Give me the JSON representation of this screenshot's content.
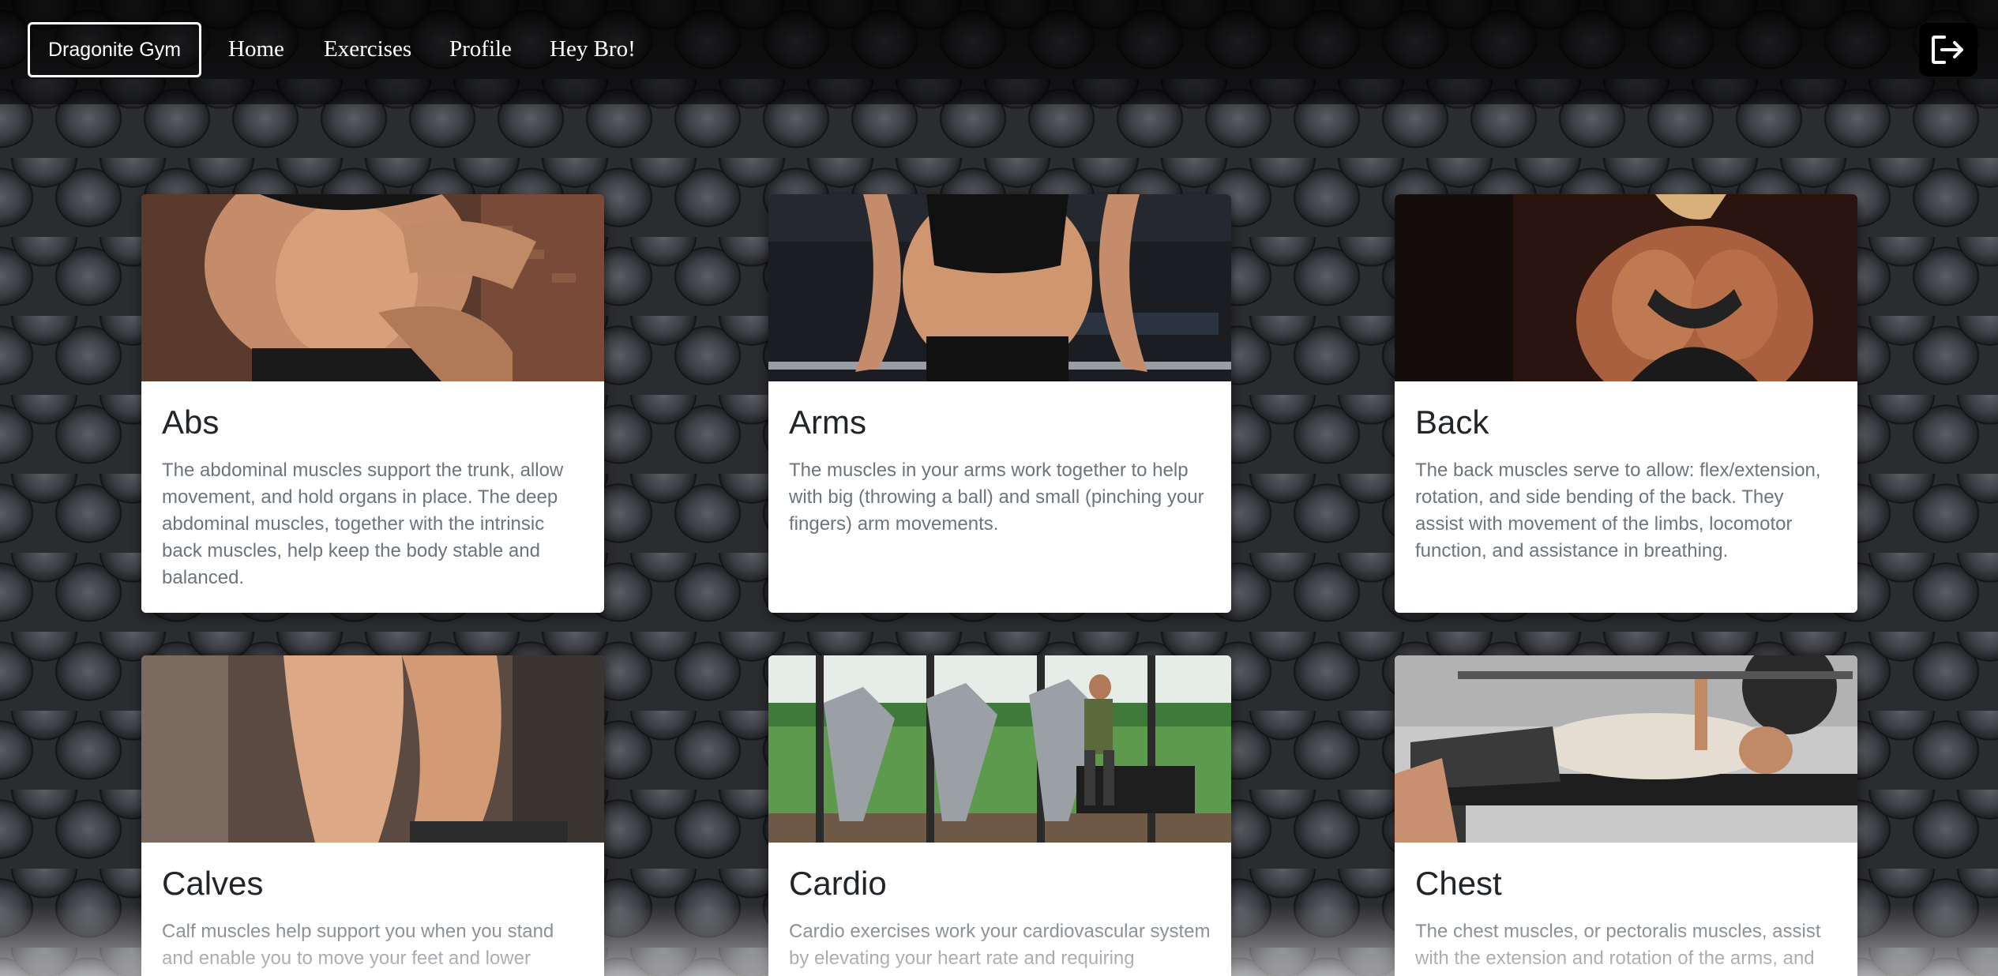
{
  "navbar": {
    "brand": "Dragonite Gym",
    "links": [
      "Home",
      "Exercises",
      "Profile",
      "Hey Bro!"
    ],
    "logout_icon": "logout-icon"
  },
  "cards": [
    {
      "title": "Abs",
      "text": "The abdominal muscles support the trunk, allow movement, and hold organs in place. The deep abdominal muscles, together with the intrinsic back muscles, help keep the body stable and balanced."
    },
    {
      "title": "Arms",
      "text": "The muscles in your arms work together to help with big (throwing a ball) and small (pinching your fingers) arm movements."
    },
    {
      "title": "Back",
      "text": "The back muscles serve to allow: flex/extension, rotation, and side bending of the back. They assist with movement of the limbs, locomotor function, and assistance in breathing."
    },
    {
      "title": "Calves",
      "text": "Calf muscles help support you when you stand and enable you to move your feet and lower"
    },
    {
      "title": "Cardio",
      "text": "Cardio exercises work your cardiovascular system by elevating your heart rate and requiring"
    },
    {
      "title": "Chest",
      "text": "The chest muscles, or pectoralis muscles, assist with the extension and rotation of the arms, and"
    }
  ],
  "colors": {
    "navbar_bg": "#000000",
    "card_bg": "#ffffff",
    "title": "#212529",
    "text": "#6c757d"
  }
}
